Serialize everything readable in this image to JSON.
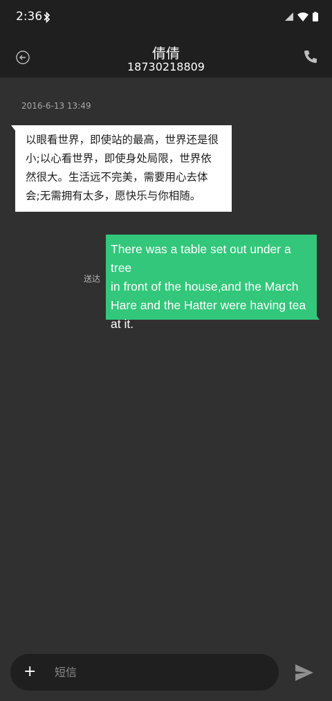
{
  "status_bar": {
    "time": "2:36",
    "icons": [
      "bluetooth-icon",
      "signal-icon",
      "wifi-icon",
      "battery-icon"
    ]
  },
  "header": {
    "contact_name": "倩倩",
    "contact_number": "18730218809",
    "back_icon": "back-circle-icon",
    "call_icon": "phone-icon"
  },
  "conversation": {
    "timestamp": "2016-6-13 13:49",
    "incoming_lines": [
      "以眼看世界，即使站的最高，世界还是很",
      "小;以心看世界，即使身处局限，世界依",
      "然很大。生活远不完美，需要用心去体",
      "会;无需拥有太多，愿快乐与你相随。"
    ],
    "outgoing_status": "送达",
    "outgoing_lines": [
      "There was a table set out under a tree",
      "in front of the house,and the March",
      "Hare and the Hatter were having tea",
      "at it."
    ]
  },
  "composer": {
    "add_label": "+",
    "placeholder": "短信",
    "send_icon": "send-icon"
  },
  "colors": {
    "background": "#303030",
    "bar": "#1f1f1f",
    "incoming_bubble": "#ffffff",
    "outgoing_bubble": "#32c77a"
  }
}
